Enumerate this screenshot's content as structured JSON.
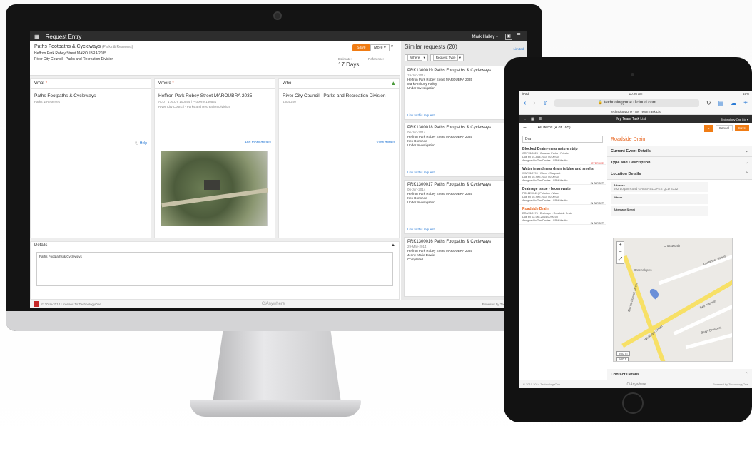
{
  "desktop": {
    "header": {
      "title": "Request Entry",
      "user": "Mark Halley"
    },
    "request": {
      "title": "Paths Footpaths & Cycleways",
      "category": "(Parks & Reserves)",
      "location": "Heffron Park Robey Street MAROUBRA 2035",
      "division": "River City Council - Parks and Recreation Division",
      "save_label": "Save",
      "more_label": "More",
      "estimate_label": "Estimate:",
      "estimate_value": "17 Days",
      "reference_label": "Reference:"
    },
    "columns": {
      "what": {
        "head": "What",
        "main": "Paths Footpaths & Cycleways",
        "sub": "Parks & Reserves",
        "link": "Help"
      },
      "where": {
        "head": "Where",
        "main": "Heffron Park Robey Street MAROUBRA 2035",
        "sub1": "ALOT 1 ALOT 100554 | Property 150551",
        "sub2": "River City Council - Parks and Recreation Division",
        "link": "Add more details"
      },
      "who": {
        "head": "Who",
        "main": "River City Council - Parks and Recreation Division",
        "sub": "4304 200",
        "link": "View details"
      }
    },
    "details": {
      "head": "Details",
      "text": "Paths Footpaths & Cycleways"
    },
    "similar": {
      "title": "Similar requests (20)",
      "limited": "Limited",
      "filter_where": "Where",
      "filter_type": "Request Type",
      "link_label": "Link to this request",
      "cards": [
        {
          "title": "PRK1300019 Paths Footpaths & Cycleways",
          "date": "19-Jun-2014",
          "loc": "Heffron Park Robey Street MAROUBRA 2035",
          "person": "Mark Anthony Halley",
          "status": "Under Investigation"
        },
        {
          "title": "PRK1300018 Paths Footpaths & Cycleways",
          "date": "06-Jun-2014",
          "loc": "Heffron Park Robey Street MAROUBRA 2035",
          "person": "Ken Donohoe",
          "status": "Under Investigation"
        },
        {
          "title": "PRK1300017 Paths Footpaths & Cycleways",
          "date": "06-Jun-2014",
          "loc": "Heffron Park Robey Street MAROUBRA 2035",
          "person": "Ken Donohoe",
          "status": "Under Investigation"
        },
        {
          "title": "PRK1300016 Paths Footpaths & Cycleways",
          "date": "29-May-2014",
          "loc": "Heffron Park Robey Street MAROUBRA 2035",
          "person": "Jenny Marie Dowie",
          "status": "Completed"
        }
      ]
    },
    "footer": {
      "copyright": "© 2010-2014 Licensed To TechnologyOne",
      "brand": "CiAnywhere",
      "powered": "Powered by TechnologyOne"
    }
  },
  "tablet": {
    "status": {
      "device": "iPad",
      "time": "10:26 am",
      "battery": "45%"
    },
    "url": "technologyone.t1cloud.com",
    "page_title": "TechnologyOne - My Team Task List",
    "bar": {
      "title": "My Team Task List",
      "right": "Technology One Ltd"
    },
    "list": {
      "head": "All Items (4 of 185)",
      "search": "Dra",
      "items": [
        {
          "title": "Blocked Drain - near nature strip",
          "l1": "CRP13/0023 | Caravan Parks - Private",
          "l2": "Due by 04-Aug-2014 00:00:00",
          "l3": "Assigned to Tim Davies | CRM Health",
          "status": "OVERDUE",
          "color": "#e53935"
        },
        {
          "title": "Water in and near drain is blue and smells",
          "l1": "WAT13/0799 | Water - Stagnant",
          "l2": "Due by 05-Sep-2014 00:00:00",
          "l3": "Assigned to Tim Davies | CRM Health",
          "status": "IN TARGET",
          "color": "#333333"
        },
        {
          "title": "Drainage issue - brown water",
          "l1": "POL12/0043 | Pollution - Water",
          "l2": "Due by 05-Sep-2014 00:00:00",
          "l3": "Assigned to Tim Davies | CRM Health",
          "status": "IN TARGET",
          "color": "#333333"
        },
        {
          "title": "Roadside Drain",
          "l1": "DRA13/0176 | Drainage - Roadside Drain",
          "l2": "Due by 02-Oct-2014 00:00:00",
          "l3": "Assigned to Tim Davies | CRM Health",
          "status": "IN TARGET",
          "color": "#333333"
        }
      ]
    },
    "detail": {
      "cancel": "Cancel",
      "save": "Save",
      "title": "Roadside Drain",
      "sections": [
        "Current Event Details",
        "Type and Description",
        "Location Details",
        "Contact Details"
      ],
      "address_label": "Address",
      "address_value": "692 Logan Road GREENSLOPES QLD 4322",
      "where_label": "Where",
      "alt_street_label": "Alternate Street",
      "map_labels": [
        "Greenslopes",
        "Chatsworth",
        "Mount Gravatt Street",
        "Lochinvar Street",
        "Bell Avenue",
        "Beryl Crescent",
        "Wickham Street"
      ],
      "scale": [
        "200 m",
        "500 ft"
      ]
    },
    "footer": {
      "copyright": "© 2010-2014 TechnologyOne",
      "brand": "CiAnywhere",
      "powered": "Powered by TechnologyOne"
    }
  }
}
